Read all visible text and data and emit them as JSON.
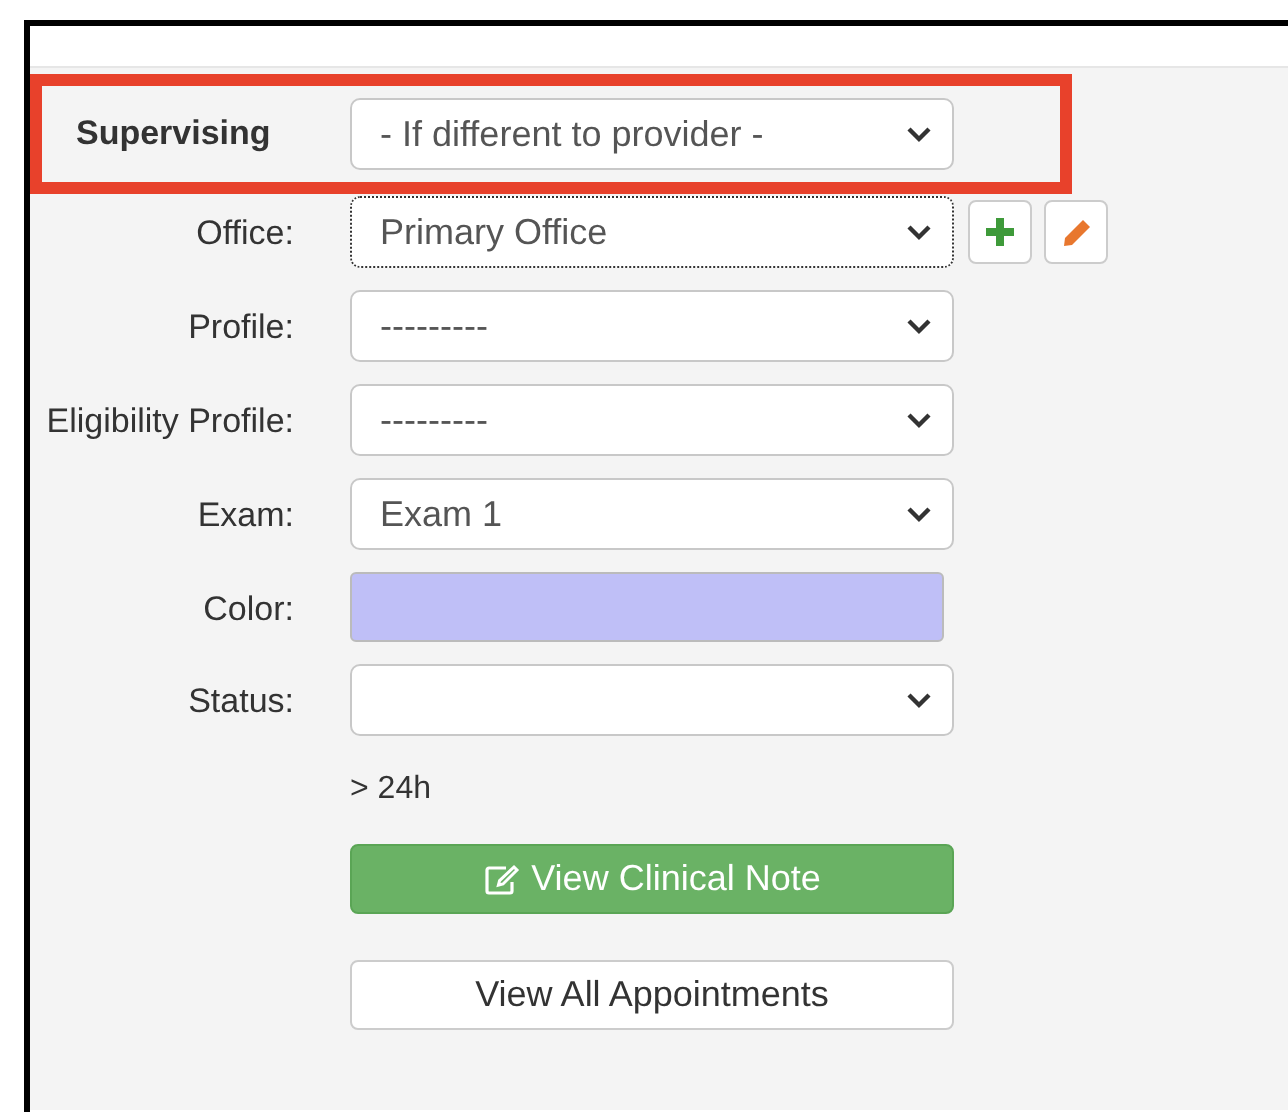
{
  "highlighted_field": {
    "label": "Supervising",
    "value": "- If different to provider -"
  },
  "fields": [
    {
      "kind": "select",
      "label": "Office:",
      "value": "Primary Office",
      "focused": true,
      "actions": [
        {
          "kind": "add"
        },
        {
          "kind": "edit"
        }
      ]
    },
    {
      "kind": "select",
      "label": "Profile:",
      "value": "---------",
      "focused": false
    },
    {
      "kind": "select",
      "label": "Eligibility Profile:",
      "value": "---------",
      "focused": false
    },
    {
      "kind": "select",
      "label": "Exam:",
      "value": "Exam 1",
      "focused": false
    },
    {
      "kind": "color",
      "label": "Color:",
      "color": "#bfbff7"
    },
    {
      "kind": "select",
      "label": "Status:",
      "focused": false
    }
  ],
  "note": "> 24h",
  "buttons": [
    {
      "kind": "primary",
      "label": "View Clinical Note"
    },
    {
      "kind": "default",
      "label": "View All Appointments"
    }
  ]
}
